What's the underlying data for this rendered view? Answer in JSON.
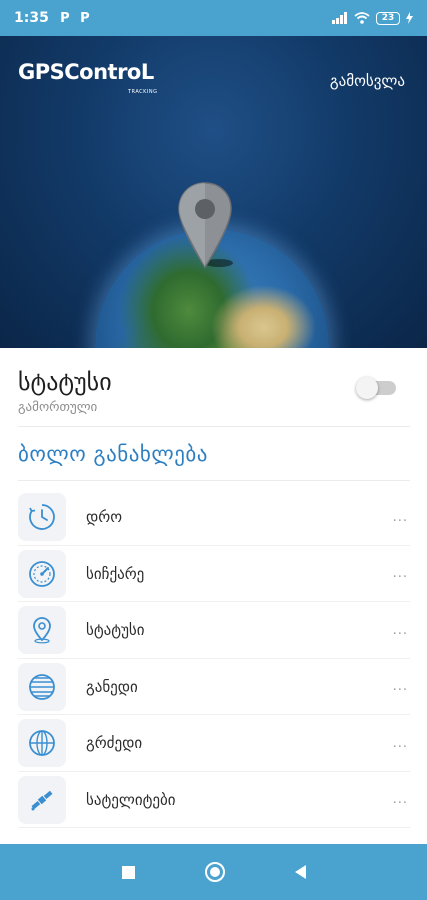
{
  "status_bar": {
    "time": "1:35",
    "notification_icons": [
      "P",
      "P"
    ],
    "battery_level": "23",
    "icons": [
      "signal-icon",
      "wifi-icon",
      "battery-icon",
      "charging-icon"
    ]
  },
  "header": {
    "logo_text": "GPSControL",
    "logo_subtext": "TRACKING",
    "logout_label": "გამოსვლა"
  },
  "status": {
    "title": "სტატუსი",
    "subtitle": "გამორთული",
    "toggle_on": false
  },
  "last_update": {
    "title": "ბოლო განახლება",
    "items": [
      {
        "icon": "clock-icon",
        "label": "დრო",
        "value": "..."
      },
      {
        "icon": "speedometer-icon",
        "label": "სიჩქარე",
        "value": "..."
      },
      {
        "icon": "location-pin-icon",
        "label": "სტატუსი",
        "value": "..."
      },
      {
        "icon": "latitude-icon",
        "label": "განედი",
        "value": "..."
      },
      {
        "icon": "longitude-icon",
        "label": "გრძედი",
        "value": "..."
      },
      {
        "icon": "satellite-icon",
        "label": "სატელიტები",
        "value": "..."
      }
    ]
  },
  "colors": {
    "accent": "#4aa3cf",
    "title_blue": "#2d7fc1",
    "hero_dark": "#0b2648"
  }
}
